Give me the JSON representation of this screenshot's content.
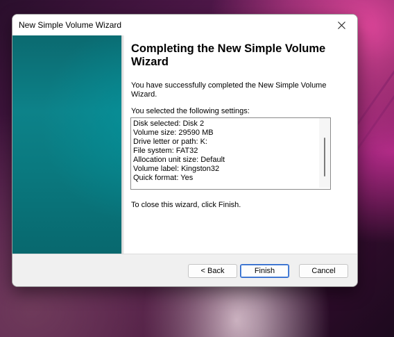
{
  "window": {
    "title": "New Simple Volume Wizard",
    "close_symbol": "✕"
  },
  "page": {
    "heading": "Completing the New Simple Volume Wizard",
    "success_message": "You have successfully completed the New Simple Volume Wizard.",
    "settings_intro": "You selected the following settings:",
    "settings": [
      "Disk selected: Disk 2",
      "Volume size: 29590 MB",
      "Drive letter or path: K:",
      "File system: FAT32",
      "Allocation unit size: Default",
      "Volume label: Kingston32",
      "Quick format: Yes"
    ],
    "close_hint": "To close this wizard, click Finish."
  },
  "buttons": {
    "back": "< Back",
    "finish": "Finish",
    "cancel": "Cancel"
  },
  "colors": {
    "banner": "#0d8289",
    "accent_border": "#2a64c8"
  },
  "icons": {
    "close": "close-icon"
  }
}
